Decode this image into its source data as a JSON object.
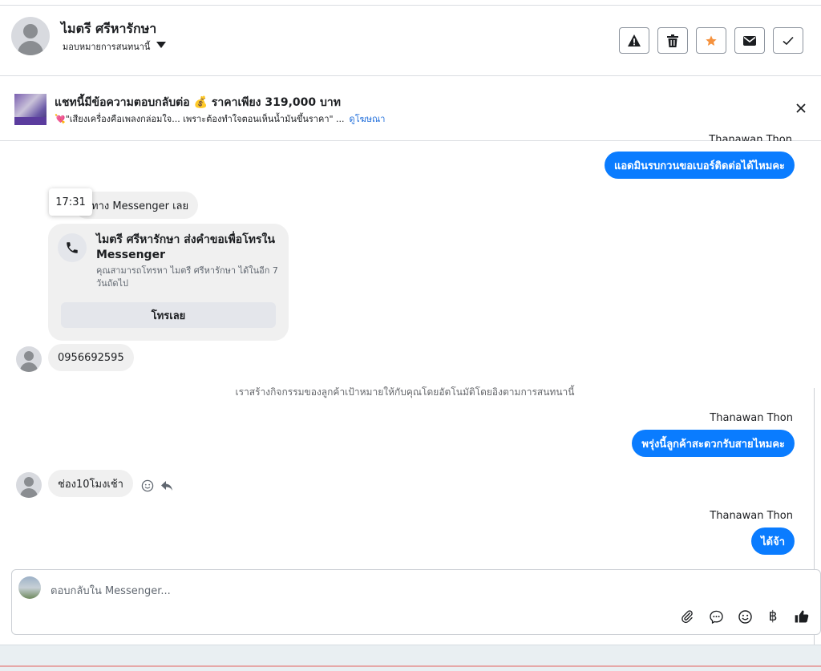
{
  "header": {
    "contact_name": "ไมตรี ศรีหารักษา",
    "assign_label": "มอบหมายการสนทนานี้",
    "toolbar": [
      "warning-icon",
      "trash-icon",
      "star-icon",
      "envelope-icon",
      "check-icon"
    ]
  },
  "ad_banner": {
    "title": "แชทนี้มีข้อความตอบกลับต่อ 💰 ราคาเพียง 319,000 บาท",
    "subtitle": "💘\"เสียงเครื่องคือเพลงกล่อมใจ... เพราะต้องทำใจตอนเห็นน้ำมันขึ้นราคา\" ...",
    "link": "ดูโฆษณา"
  },
  "messages": {
    "m1_sender": "Thanawan Thon",
    "m1_text": "แอดมินรบกวนขอเบอร์ติดต่อได้ไหมคะ",
    "m2_text": "ทาง Messenger เลย",
    "tooltip_time": "17:31",
    "call_card": {
      "title": "ไมตรี ศรีหารักษา ส่งคำขอเพื่อโทรใน Messenger",
      "desc": "คุณสามารถโทรหา ไมตรี ศรีหารักษา ได้ในอีก 7 วันถัดไป",
      "button": "โทรเลย"
    },
    "m3_text": "0956692595",
    "system_note": "เราสร้างกิจกรรมของลูกค้าเป้าหมายให้กับคุณโดยอัตโนมัติโดยอิงตามการสนทนานี้",
    "m4_sender": "Thanawan Thon",
    "m4_text": "พรุ่งนี้ลูกค้าสะดวกรับสายไหมคะ",
    "m5_text": "ช่อง10โมงเช้า",
    "m6_sender": "Thanawan Thon",
    "m6_text": "ได้จ้า"
  },
  "composer": {
    "placeholder": "ตอบกลับใน Messenger...",
    "currency_symbol": "฿"
  },
  "colors": {
    "accent": "#0a7cff",
    "star": "#f5923e"
  }
}
